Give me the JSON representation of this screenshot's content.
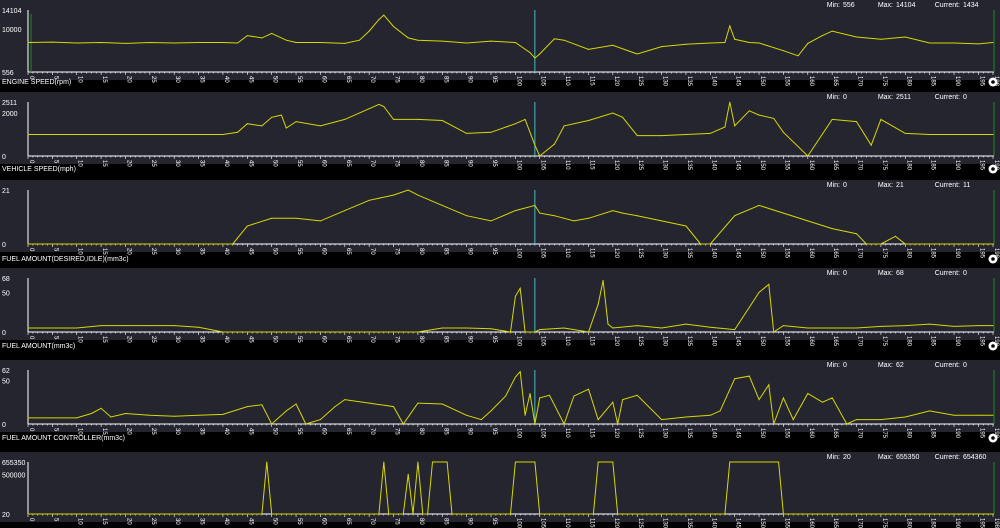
{
  "stat_labels": {
    "min": "Min:",
    "max": "Max:",
    "current": "Current:"
  },
  "colors": {
    "background": "#000000",
    "plot_bg": "#252530",
    "line": "#d8d800",
    "cursor": "#40c0c0",
    "edge_marker": "#1e8a1e",
    "axis": "#ffffff"
  },
  "icons": {
    "panel_options": "gear-icon"
  },
  "chart_data": [
    {
      "type": "line",
      "title": "",
      "stats": {
        "min": "556",
        "max": "14104",
        "current": "1434"
      },
      "yticks": [
        "14104",
        "10000",
        "556"
      ],
      "ylim": [
        556,
        14104
      ],
      "xlim": [
        0,
        198
      ],
      "cursor_x": 104,
      "x": [
        0,
        5,
        10,
        15,
        20,
        25,
        30,
        35,
        40,
        43,
        45,
        48,
        50,
        53,
        55,
        60,
        65,
        68,
        70,
        72,
        73,
        75,
        78,
        80,
        85,
        90,
        95,
        100,
        103,
        104,
        105,
        108,
        110,
        115,
        120,
        125,
        130,
        135,
        140,
        143,
        144,
        145,
        148,
        150,
        155,
        158,
        160,
        163,
        165,
        170,
        175,
        180,
        185,
        190,
        195,
        198
      ],
      "y": [
        7000,
        7100,
        6900,
        7000,
        6800,
        7000,
        6900,
        7000,
        7000,
        6900,
        8500,
        8000,
        9000,
        7500,
        7000,
        7000,
        6800,
        7500,
        9500,
        12000,
        13000,
        10500,
        8000,
        7500,
        7300,
        6900,
        7300,
        7000,
        4800,
        3600,
        4500,
        7800,
        7500,
        5500,
        6400,
        4500,
        6100,
        6600,
        6900,
        7000,
        10600,
        7700,
        7000,
        6900,
        5200,
        4100,
        6800,
        8500,
        9500,
        8200,
        7700,
        8200,
        6900,
        6900,
        6700,
        7000
      ]
    },
    {
      "type": "line",
      "title": "ENGINE SPEED(rpm)",
      "stats": {
        "min": "0",
        "max": "2511",
        "current": "0"
      },
      "yticks": [
        "2511",
        "2000",
        "0"
      ],
      "ylim": [
        0,
        2511
      ],
      "xlim": [
        0,
        198
      ],
      "cursor_x": 104,
      "x": [
        0,
        5,
        10,
        15,
        20,
        25,
        30,
        35,
        40,
        43,
        45,
        48,
        50,
        52,
        53,
        55,
        60,
        65,
        70,
        72,
        73,
        75,
        80,
        85,
        90,
        95,
        100,
        102,
        104,
        105,
        108,
        110,
        115,
        120,
        122,
        125,
        130,
        135,
        140,
        143,
        144,
        145,
        148,
        150,
        153,
        155,
        160,
        165,
        170,
        173,
        175,
        180,
        185,
        190,
        195,
        198
      ],
      "y": [
        1000,
        1000,
        1000,
        1000,
        1000,
        1000,
        1000,
        1000,
        1000,
        1100,
        1500,
        1400,
        1800,
        1900,
        1300,
        1600,
        1400,
        1700,
        2200,
        2400,
        2300,
        1700,
        1700,
        1650,
        1050,
        1100,
        1500,
        1700,
        500,
        0,
        550,
        1400,
        1650,
        2000,
        1800,
        950,
        950,
        1000,
        1050,
        1350,
        2500,
        1400,
        2100,
        1900,
        1750,
        1100,
        0,
        1700,
        1600,
        500,
        1700,
        1050,
        1000,
        1000,
        1000,
        1000
      ]
    },
    {
      "type": "line",
      "title": "VEHICLE SPEED(mph)",
      "stats": {
        "min": "0",
        "max": "21",
        "current": "11"
      },
      "yticks": [
        "21",
        "0"
      ],
      "ylim": [
        0,
        21
      ],
      "xlim": [
        0,
        198
      ],
      "cursor_x": 104,
      "x": [
        0,
        5,
        10,
        15,
        20,
        25,
        30,
        35,
        40,
        42,
        45,
        50,
        55,
        60,
        65,
        70,
        75,
        78,
        80,
        85,
        90,
        95,
        100,
        104,
        105,
        108,
        110,
        112,
        115,
        120,
        122,
        125,
        130,
        135,
        138,
        140,
        145,
        150,
        155,
        160,
        165,
        170,
        172,
        175,
        178,
        180,
        185,
        190,
        195,
        198
      ],
      "y": [
        0,
        0,
        0,
        0,
        0,
        0,
        0,
        0,
        0,
        0,
        7,
        10,
        10,
        9,
        13,
        17,
        19,
        21,
        19,
        15,
        11,
        9,
        13,
        15,
        12,
        11,
        10,
        9,
        10,
        13,
        12,
        11,
        9,
        7,
        0,
        0,
        11,
        15,
        12,
        9,
        6,
        4,
        0,
        0,
        3,
        0,
        0,
        0,
        0,
        0
      ]
    },
    {
      "type": "line",
      "title": "FUEL AMOUNT(DESIRED,IDLE)(mm3c)",
      "stats": {
        "min": "0",
        "max": "68",
        "current": "0"
      },
      "yticks": [
        "68",
        "50",
        "0"
      ],
      "ylim": [
        0,
        68
      ],
      "xlim": [
        0,
        198
      ],
      "cursor_x": 104,
      "x": [
        0,
        5,
        10,
        15,
        20,
        25,
        30,
        35,
        40,
        42,
        45,
        50,
        55,
        60,
        65,
        70,
        75,
        80,
        85,
        90,
        95,
        99,
        100,
        101,
        102,
        103,
        104,
        105,
        110,
        115,
        117,
        118,
        119,
        120,
        125,
        130,
        135,
        140,
        145,
        150,
        152,
        153,
        155,
        160,
        165,
        170,
        175,
        180,
        185,
        190,
        195,
        198
      ],
      "y": [
        5,
        5,
        5,
        8,
        8,
        8,
        8,
        6,
        0,
        0,
        0,
        0,
        0,
        0,
        0,
        0,
        0,
        0,
        5,
        5,
        4,
        0,
        45,
        55,
        0,
        0,
        0,
        3,
        5,
        0,
        35,
        65,
        10,
        5,
        8,
        5,
        10,
        6,
        3,
        50,
        60,
        0,
        8,
        5,
        5,
        5,
        7,
        8,
        10,
        7,
        8,
        8
      ]
    },
    {
      "type": "line",
      "title": "FUEL AMOUNT(mm3c)",
      "stats": {
        "min": "0",
        "max": "62",
        "current": "0"
      },
      "yticks": [
        "62",
        "50",
        "0"
      ],
      "ylim": [
        0,
        62
      ],
      "xlim": [
        0,
        198
      ],
      "cursor_x": 104,
      "x": [
        0,
        5,
        10,
        13,
        15,
        17,
        20,
        25,
        30,
        35,
        40,
        45,
        48,
        50,
        53,
        55,
        57,
        60,
        63,
        65,
        70,
        75,
        77,
        80,
        85,
        90,
        93,
        95,
        98,
        100,
        101,
        102,
        103,
        104,
        105,
        107,
        110,
        112,
        115,
        117,
        120,
        121,
        122,
        125,
        130,
        135,
        140,
        142,
        145,
        148,
        150,
        152,
        153,
        155,
        157,
        160,
        163,
        165,
        168,
        170,
        175,
        180,
        185,
        190,
        195,
        198
      ],
      "y": [
        7,
        7,
        7,
        12,
        18,
        8,
        12,
        10,
        9,
        10,
        11,
        20,
        22,
        0,
        15,
        23,
        0,
        5,
        20,
        28,
        24,
        20,
        0,
        24,
        23,
        10,
        5,
        15,
        32,
        54,
        60,
        10,
        35,
        0,
        30,
        33,
        0,
        32,
        40,
        5,
        25,
        0,
        28,
        33,
        5,
        8,
        10,
        15,
        52,
        55,
        28,
        45,
        0,
        30,
        5,
        35,
        25,
        30,
        0,
        5,
        5,
        8,
        15,
        10,
        10,
        10
      ]
    },
    {
      "type": "line",
      "title": "FUEL AMOUNT CONTROLLER(mm3c)",
      "stats": {
        "min": "20",
        "max": "655350",
        "current": "654360"
      },
      "yticks": [
        "655350",
        "500000",
        "20"
      ],
      "ylim": [
        20,
        655350
      ],
      "xlim": [
        0,
        198
      ],
      "cursor_x": null,
      "x": [
        0,
        5,
        10,
        15,
        20,
        25,
        30,
        35,
        40,
        45,
        48,
        49,
        50,
        51,
        55,
        60,
        65,
        70,
        72,
        73,
        74,
        75,
        77,
        78,
        79,
        80,
        81,
        82,
        83,
        84,
        85,
        86,
        87,
        90,
        95,
        98,
        99,
        100,
        101,
        102,
        103,
        104,
        105,
        110,
        115,
        116,
        117,
        118,
        119,
        120,
        121,
        122,
        125,
        130,
        135,
        140,
        142,
        143,
        144,
        145,
        146,
        152,
        153,
        154,
        155,
        160,
        165,
        170,
        175,
        180,
        185,
        190,
        195,
        198
      ],
      "y": [
        20,
        20,
        20,
        20,
        20,
        20,
        20,
        20,
        20,
        20,
        20,
        655350,
        20,
        20,
        20,
        20,
        20,
        20,
        20,
        655350,
        20,
        20,
        20,
        500000,
        20,
        655350,
        20,
        20,
        655350,
        655350,
        655350,
        655350,
        20,
        20,
        20,
        20,
        20,
        655350,
        655350,
        655350,
        655350,
        655350,
        20,
        20,
        20,
        20,
        655350,
        655350,
        655350,
        655350,
        20,
        20,
        20,
        20,
        20,
        20,
        20,
        20,
        655350,
        655350,
        655350,
        655350,
        655350,
        655350,
        20,
        20,
        20,
        20,
        20,
        20,
        20,
        20,
        20,
        20
      ]
    }
  ]
}
